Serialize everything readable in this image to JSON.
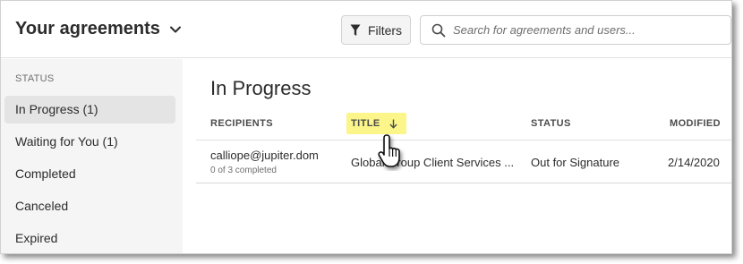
{
  "header": {
    "title": "Your agreements",
    "filters_label": "Filters",
    "search_placeholder": "Search for agreements and users..."
  },
  "sidebar": {
    "section_label": "STATUS",
    "items": [
      {
        "label": "In Progress (1)",
        "active": true
      },
      {
        "label": "Waiting for You (1)",
        "active": false
      },
      {
        "label": "Completed",
        "active": false
      },
      {
        "label": "Canceled",
        "active": false
      },
      {
        "label": "Expired",
        "active": false
      }
    ]
  },
  "main": {
    "heading": "In Progress",
    "columns": {
      "recipients": "RECIPIENTS",
      "title": "TITLE",
      "status": "STATUS",
      "modified": "MODIFIED"
    },
    "rows": [
      {
        "recipient": "calliope@jupiter.dom",
        "progress": "0 of 3 completed",
        "title": "Global Group Client Services ...",
        "status": "Out for Signature",
        "modified": "2/14/2020"
      }
    ]
  },
  "colors": {
    "highlight": "#fbf58a",
    "sidebar_bg": "#f5f5f5",
    "active_item_bg": "#e4e4e4"
  },
  "icons": [
    "chevron-down-icon",
    "filter-icon",
    "search-icon",
    "sort-down-arrow-icon",
    "hand-pointer-cursor-icon"
  ]
}
